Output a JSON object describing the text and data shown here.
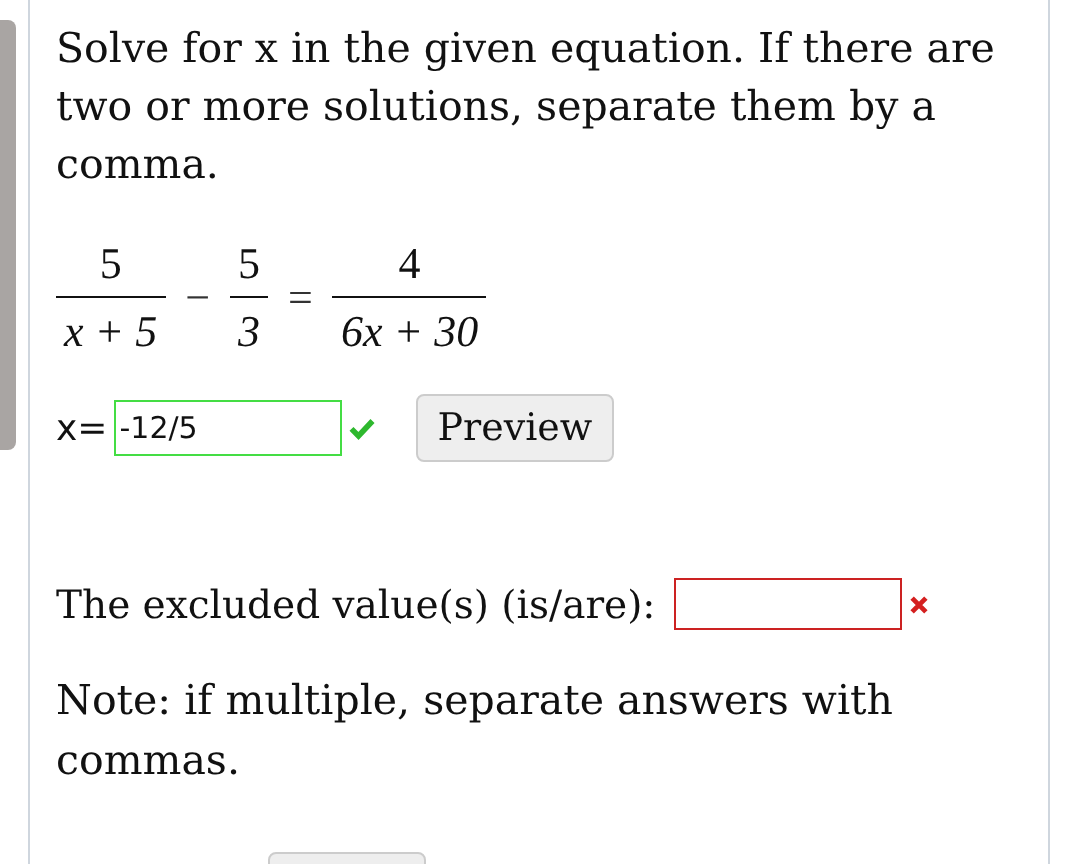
{
  "question": {
    "prompt": "Solve for x in the given equation. If there are two or more solutions, separate them by a comma.",
    "equation": [
      {
        "kind": "fraction",
        "numerator": "5",
        "denominator": "x + 5"
      },
      {
        "kind": "operator",
        "text": "−"
      },
      {
        "kind": "fraction",
        "numerator": "5",
        "denominator": "3"
      },
      {
        "kind": "operator",
        "text": "="
      },
      {
        "kind": "fraction",
        "numerator": "4",
        "denominator": "6x + 30"
      }
    ],
    "answer": {
      "label": "x=",
      "value": "-12/5",
      "correct": true
    },
    "preview_button": "Preview",
    "excluded": {
      "label": "The excluded value(s) (is/are):",
      "correct": false
    },
    "note": "Note: if multiple, separate answers with commas."
  }
}
